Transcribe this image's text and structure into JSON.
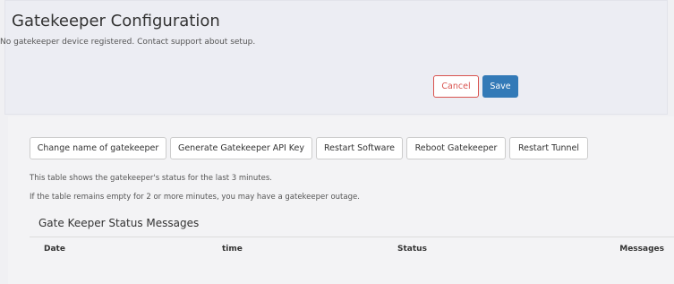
{
  "header": {
    "title": "Gatekeeper Configuration",
    "subtitle": "No gatekeeper device registered. Contact support about setup."
  },
  "form_actions": {
    "cancel_label": "Cancel",
    "save_label": "Save"
  },
  "toolbar": {
    "buttons": [
      "Change name of gatekeeper",
      "Generate Gatekeeper API Key",
      "Restart Software",
      "Reboot Gatekeeper",
      "Restart Tunnel"
    ]
  },
  "info": {
    "line1": "This table shows the gatekeeper's status for the last 3 minutes.",
    "line2": "If the table remains empty for 2 or more minutes, you may have a gatekeeper outage."
  },
  "status_table": {
    "title": "Gate Keeper Status Messages",
    "columns": [
      "Date",
      "time",
      "Status",
      "Messages"
    ],
    "rows": []
  },
  "colors": {
    "primary": "#337ab7",
    "danger": "#d9534f"
  }
}
